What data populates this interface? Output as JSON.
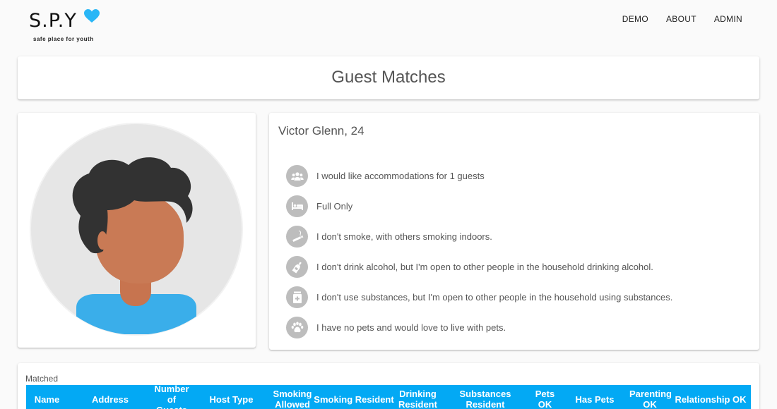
{
  "header": {
    "logo_text": "S.P.Y",
    "logo_tagline": "safe place for youth",
    "nav": [
      "DEMO",
      "ABOUT",
      "ADMIN"
    ]
  },
  "title": "Guest Matches",
  "guest": {
    "name": "Victor Glenn, 24",
    "preferences": [
      {
        "icon": "people-icon",
        "text": "I would like accommodations for 1 guests"
      },
      {
        "icon": "bed-icon",
        "text": "Full Only"
      },
      {
        "icon": "smoking-icon",
        "text": "I don't smoke, with others smoking indoors."
      },
      {
        "icon": "bottle-icon",
        "text": "I don't drink alcohol, but I'm open to other people in the household drinking alcohol."
      },
      {
        "icon": "medicine-icon",
        "text": "I don't use substances, but I'm open to other people in the household using substances."
      },
      {
        "icon": "paw-icon",
        "text": "I have no pets and would love to live with pets."
      }
    ]
  },
  "table": {
    "label": "Matched",
    "columns": [
      "Name",
      "Address",
      "Number of Guests",
      "Host Type",
      "Smoking Allowed",
      "Smoking Resident",
      "Drinking Resident",
      "Substances Resident",
      "Pets OK",
      "Has Pets",
      "Parenting OK",
      "Relationship OK"
    ],
    "header_color": "#03a9f4"
  },
  "colors": {
    "accent": "#03a9f4",
    "icon_bg": "#bdbdbd"
  }
}
